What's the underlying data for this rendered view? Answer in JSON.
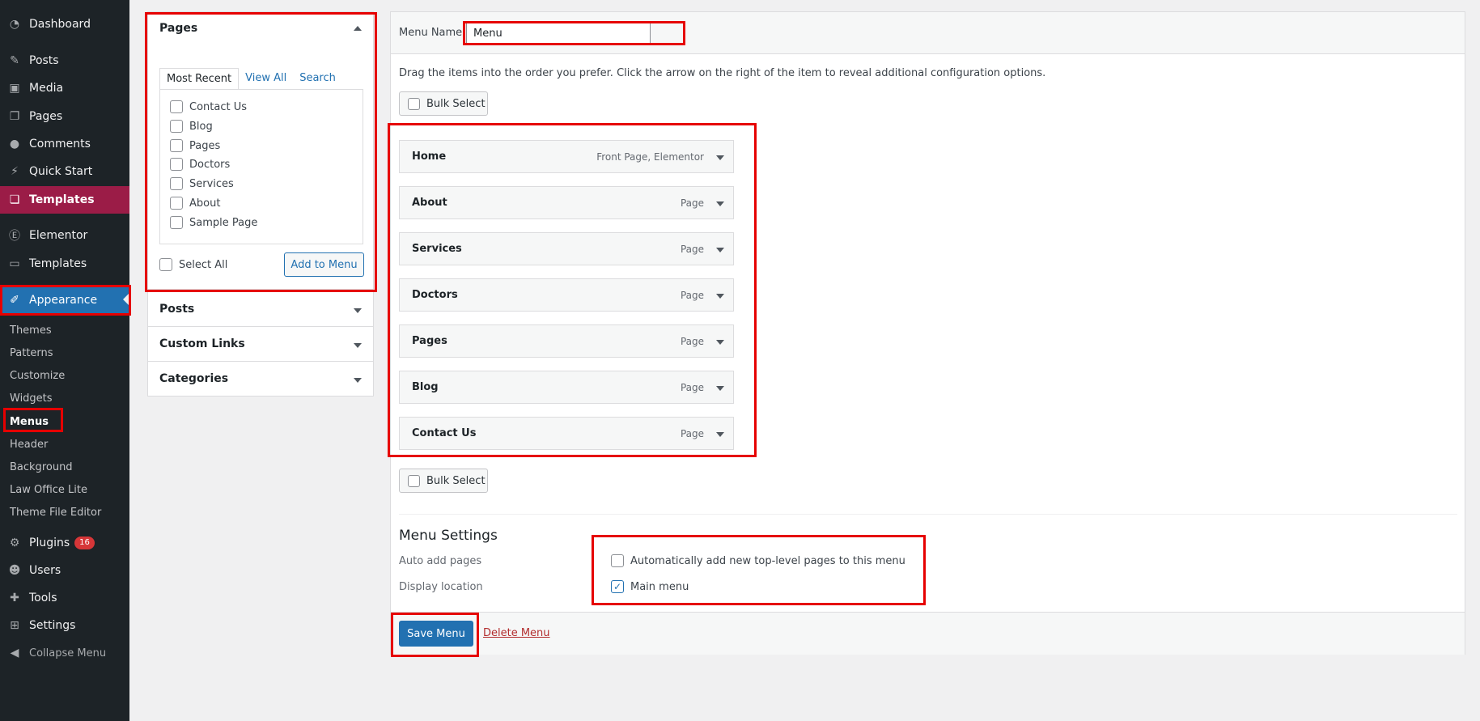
{
  "sidebar": {
    "items": [
      {
        "label": "Dashboard",
        "icon": "dashboard-icon"
      },
      {
        "label": "Posts",
        "icon": "pin-icon"
      },
      {
        "label": "Media",
        "icon": "media-icon"
      },
      {
        "label": "Pages",
        "icon": "pages-icon"
      },
      {
        "label": "Comments",
        "icon": "comments-icon"
      },
      {
        "label": "Quick Start",
        "icon": "plug-icon"
      },
      {
        "label": "Templates",
        "icon": "templates-icon"
      },
      {
        "label": "Elementor",
        "icon": "elementor-icon"
      },
      {
        "label": "Templates",
        "icon": "folder-icon"
      },
      {
        "label": "Appearance",
        "icon": "brush-icon"
      }
    ],
    "appearance_sub": [
      "Themes",
      "Patterns",
      "Customize",
      "Widgets",
      "Menus",
      "Header",
      "Background",
      "Law Office Lite",
      "Theme File Editor"
    ],
    "lower_items": [
      {
        "label": "Plugins",
        "icon": "plugin-icon",
        "badge": "16"
      },
      {
        "label": "Users",
        "icon": "users-icon"
      },
      {
        "label": "Tools",
        "icon": "wrench-icon"
      },
      {
        "label": "Settings",
        "icon": "settings-icon"
      }
    ],
    "collapse_label": "Collapse Menu"
  },
  "left_panel": {
    "pages_title": "Pages",
    "tabs": [
      "Most Recent",
      "View All",
      "Search"
    ],
    "pages": [
      "Contact Us",
      "Blog",
      "Pages",
      "Doctors",
      "Services",
      "About",
      "Sample Page"
    ],
    "select_all": "Select All",
    "add_to_menu": "Add to Menu",
    "other_sections": [
      "Posts",
      "Custom Links",
      "Categories"
    ]
  },
  "menu": {
    "name_label": "Menu Name",
    "name_value": "Menu",
    "instructions": "Drag the items into the order you prefer. Click the arrow on the right of the item to reveal additional configuration options.",
    "bulk_select": "Bulk Select",
    "items": [
      {
        "title": "Home",
        "type": "Front Page, Elementor"
      },
      {
        "title": "About",
        "type": "Page"
      },
      {
        "title": "Services",
        "type": "Page"
      },
      {
        "title": "Doctors",
        "type": "Page"
      },
      {
        "title": "Pages",
        "type": "Page"
      },
      {
        "title": "Blog",
        "type": "Page"
      },
      {
        "title": "Contact Us",
        "type": "Page"
      }
    ],
    "settings_title": "Menu Settings",
    "auto_add_label": "Auto add pages",
    "auto_add_option": "Automatically add new top-level pages to this menu",
    "auto_add_checked": false,
    "display_location_label": "Display location",
    "display_location_option": "Main menu",
    "display_location_checked": true,
    "save_label": "Save Menu",
    "delete_label": "Delete Menu"
  },
  "colors": {
    "sidebar_bg": "#1d2327",
    "templates_active": "#9b1c47",
    "appearance_active": "#2271b1",
    "highlight": "#e60000",
    "primary_button": "#2271b1",
    "delete_link": "#b32d2e"
  }
}
